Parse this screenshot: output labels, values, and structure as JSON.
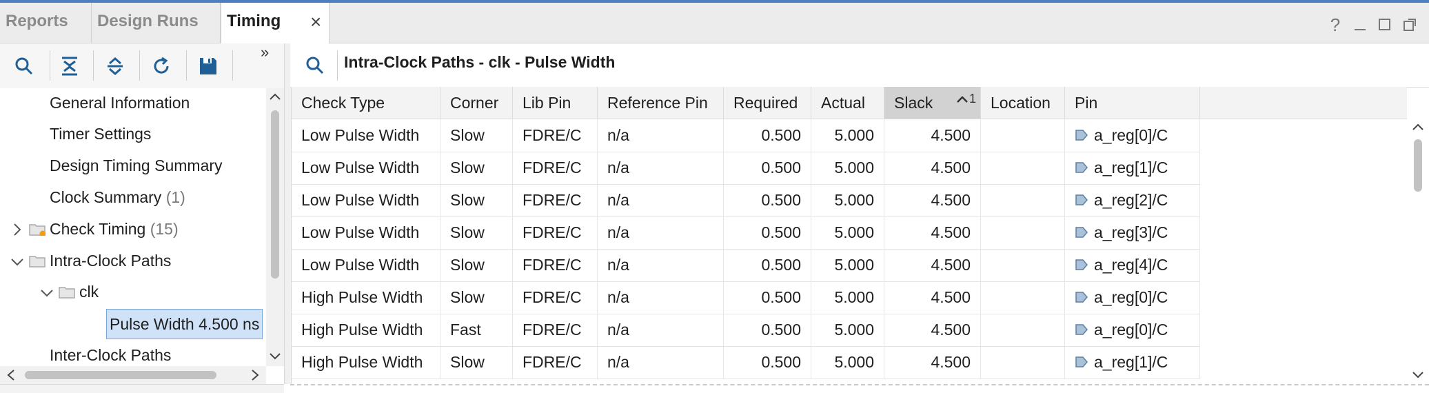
{
  "tabs": [
    {
      "label": "Reports",
      "active": false
    },
    {
      "label": "Design Runs",
      "active": false
    },
    {
      "label": "Timing",
      "active": true
    }
  ],
  "window_controls": {
    "help": "?"
  },
  "toolbar": {
    "icons": [
      "search-icon",
      "collapse-all-icon",
      "expand-all-icon",
      "refresh-icon",
      "save-icon"
    ],
    "more": "»"
  },
  "tree": {
    "items": [
      {
        "label": "General Information",
        "count": ""
      },
      {
        "label": "Timer Settings",
        "count": ""
      },
      {
        "label": "Design Timing Summary",
        "count": ""
      },
      {
        "label": "Clock Summary",
        "count": "(1)"
      },
      {
        "label": "Check Timing",
        "count": "(15)"
      },
      {
        "label": "Intra-Clock Paths",
        "count": ""
      },
      {
        "label": "clk",
        "count": ""
      },
      {
        "label": "Pulse Width 4.500 ns",
        "count": ""
      },
      {
        "label": "Inter-Clock Paths",
        "count": ""
      }
    ]
  },
  "report": {
    "title": "Intra-Clock Paths - clk - Pulse Width"
  },
  "table": {
    "columns": [
      "Check Type",
      "Corner",
      "Lib Pin",
      "Reference Pin",
      "Required",
      "Actual",
      "Slack",
      "Location",
      "Pin"
    ],
    "sort": {
      "column": "Slack",
      "order": "1"
    },
    "rows": [
      {
        "check_type": "Low Pulse Width",
        "corner": "Slow",
        "lib_pin": "FDRE/C",
        "reference_pin": "n/a",
        "required": "0.500",
        "actual": "5.000",
        "slack": "4.500",
        "location": "",
        "pin": "a_reg[0]/C"
      },
      {
        "check_type": "Low Pulse Width",
        "corner": "Slow",
        "lib_pin": "FDRE/C",
        "reference_pin": "n/a",
        "required": "0.500",
        "actual": "5.000",
        "slack": "4.500",
        "location": "",
        "pin": "a_reg[1]/C"
      },
      {
        "check_type": "Low Pulse Width",
        "corner": "Slow",
        "lib_pin": "FDRE/C",
        "reference_pin": "n/a",
        "required": "0.500",
        "actual": "5.000",
        "slack": "4.500",
        "location": "",
        "pin": "a_reg[2]/C"
      },
      {
        "check_type": "Low Pulse Width",
        "corner": "Slow",
        "lib_pin": "FDRE/C",
        "reference_pin": "n/a",
        "required": "0.500",
        "actual": "5.000",
        "slack": "4.500",
        "location": "",
        "pin": "a_reg[3]/C"
      },
      {
        "check_type": "Low Pulse Width",
        "corner": "Slow",
        "lib_pin": "FDRE/C",
        "reference_pin": "n/a",
        "required": "0.500",
        "actual": "5.000",
        "slack": "4.500",
        "location": "",
        "pin": "a_reg[4]/C"
      },
      {
        "check_type": "High Pulse Width",
        "corner": "Slow",
        "lib_pin": "FDRE/C",
        "reference_pin": "n/a",
        "required": "0.500",
        "actual": "5.000",
        "slack": "4.500",
        "location": "",
        "pin": "a_reg[0]/C"
      },
      {
        "check_type": "High Pulse Width",
        "corner": "Fast",
        "lib_pin": "FDRE/C",
        "reference_pin": "n/a",
        "required": "0.500",
        "actual": "5.000",
        "slack": "4.500",
        "location": "",
        "pin": "a_reg[0]/C"
      },
      {
        "check_type": "High Pulse Width",
        "corner": "Slow",
        "lib_pin": "FDRE/C",
        "reference_pin": "n/a",
        "required": "0.500",
        "actual": "5.000",
        "slack": "4.500",
        "location": "",
        "pin": "a_reg[1]/C"
      }
    ]
  },
  "colors": {
    "accent": "#4a7fc1",
    "selection": "#cfe2f8",
    "sorted_header": "#d2d2d2",
    "pin_icon": "#6f8fae",
    "warning_dot": "#f39c12"
  }
}
